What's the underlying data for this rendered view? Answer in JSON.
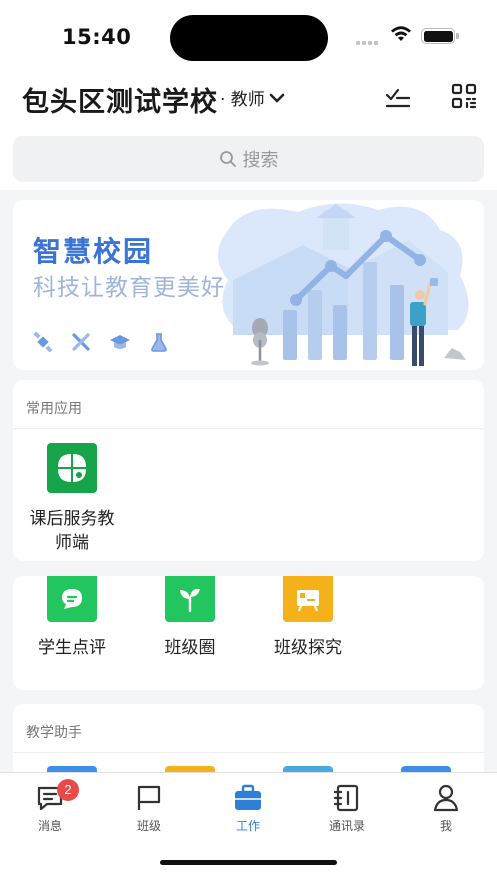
{
  "status": {
    "time": "15:40"
  },
  "header": {
    "school_name": "包头区测试学校",
    "role": "· 教师"
  },
  "search": {
    "placeholder": "搜索"
  },
  "banner": {
    "title": "智慧校园",
    "subtitle": "科技让教育更美好"
  },
  "common_apps": {
    "title": "常用应用",
    "items": [
      {
        "label": "课后服务教师端",
        "icon": "clover-icon",
        "color": "#16a34a"
      }
    ]
  },
  "apps2": {
    "items": [
      {
        "label": "学生点评",
        "icon": "comment-icon",
        "color": "#22c55e"
      },
      {
        "label": "班级圈",
        "icon": "sprout-icon",
        "color": "#22c55e"
      },
      {
        "label": "班级探究",
        "icon": "board-icon",
        "color": "#f5b11a"
      }
    ]
  },
  "teaching": {
    "title": "教学助手"
  },
  "tabbar": {
    "items": [
      {
        "label": "消息",
        "icon": "message-icon",
        "badge": "2"
      },
      {
        "label": "班级",
        "icon": "flag-icon"
      },
      {
        "label": "工作",
        "icon": "briefcase-icon",
        "active": true
      },
      {
        "label": "通讯录",
        "icon": "contacts-icon"
      },
      {
        "label": "我",
        "icon": "person-icon"
      }
    ]
  },
  "colors": {
    "accent": "#2f7fd8",
    "badge": "#e84a4a",
    "banner_title": "#3a74d6"
  }
}
